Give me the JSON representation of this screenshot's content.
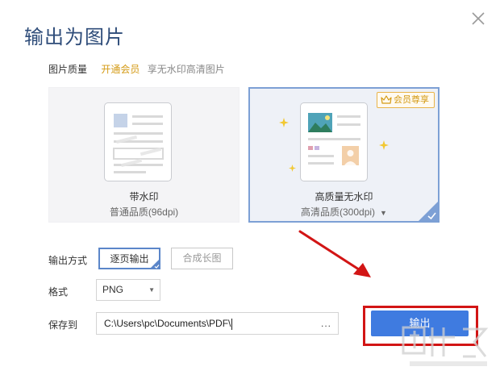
{
  "dialog": {
    "title": "输出为图片"
  },
  "quality": {
    "label": "图片质量",
    "vip_link": "开通会员",
    "vip_desc": "享无水印高清图片"
  },
  "cards": [
    {
      "label": "带水印",
      "sub": "普通品质(96dpi)"
    },
    {
      "label": "高质量无水印",
      "sub": "高清品质(300dpi)",
      "badge": "会员尊享",
      "selected": true
    }
  ],
  "output_mode": {
    "label": "输出方式",
    "options": [
      "逐页输出",
      "合成长图"
    ],
    "selected": "逐页输出"
  },
  "format": {
    "label": "格式",
    "value": "PNG"
  },
  "save": {
    "label": "保存到",
    "path": "C:\\Users\\pc\\Documents\\PDF\\",
    "browse": "..."
  },
  "export_button": "输出",
  "colors": {
    "accent": "#3f7be0",
    "title": "#2f4d7a",
    "vip": "#d49a14",
    "highlight": "#d21515",
    "selected_border": "#7da0d5"
  },
  "icons": [
    "close-icon",
    "crown-icon",
    "check-icon",
    "star-icon",
    "image-icon",
    "avatar-icon",
    "chevron-down-icon"
  ]
}
